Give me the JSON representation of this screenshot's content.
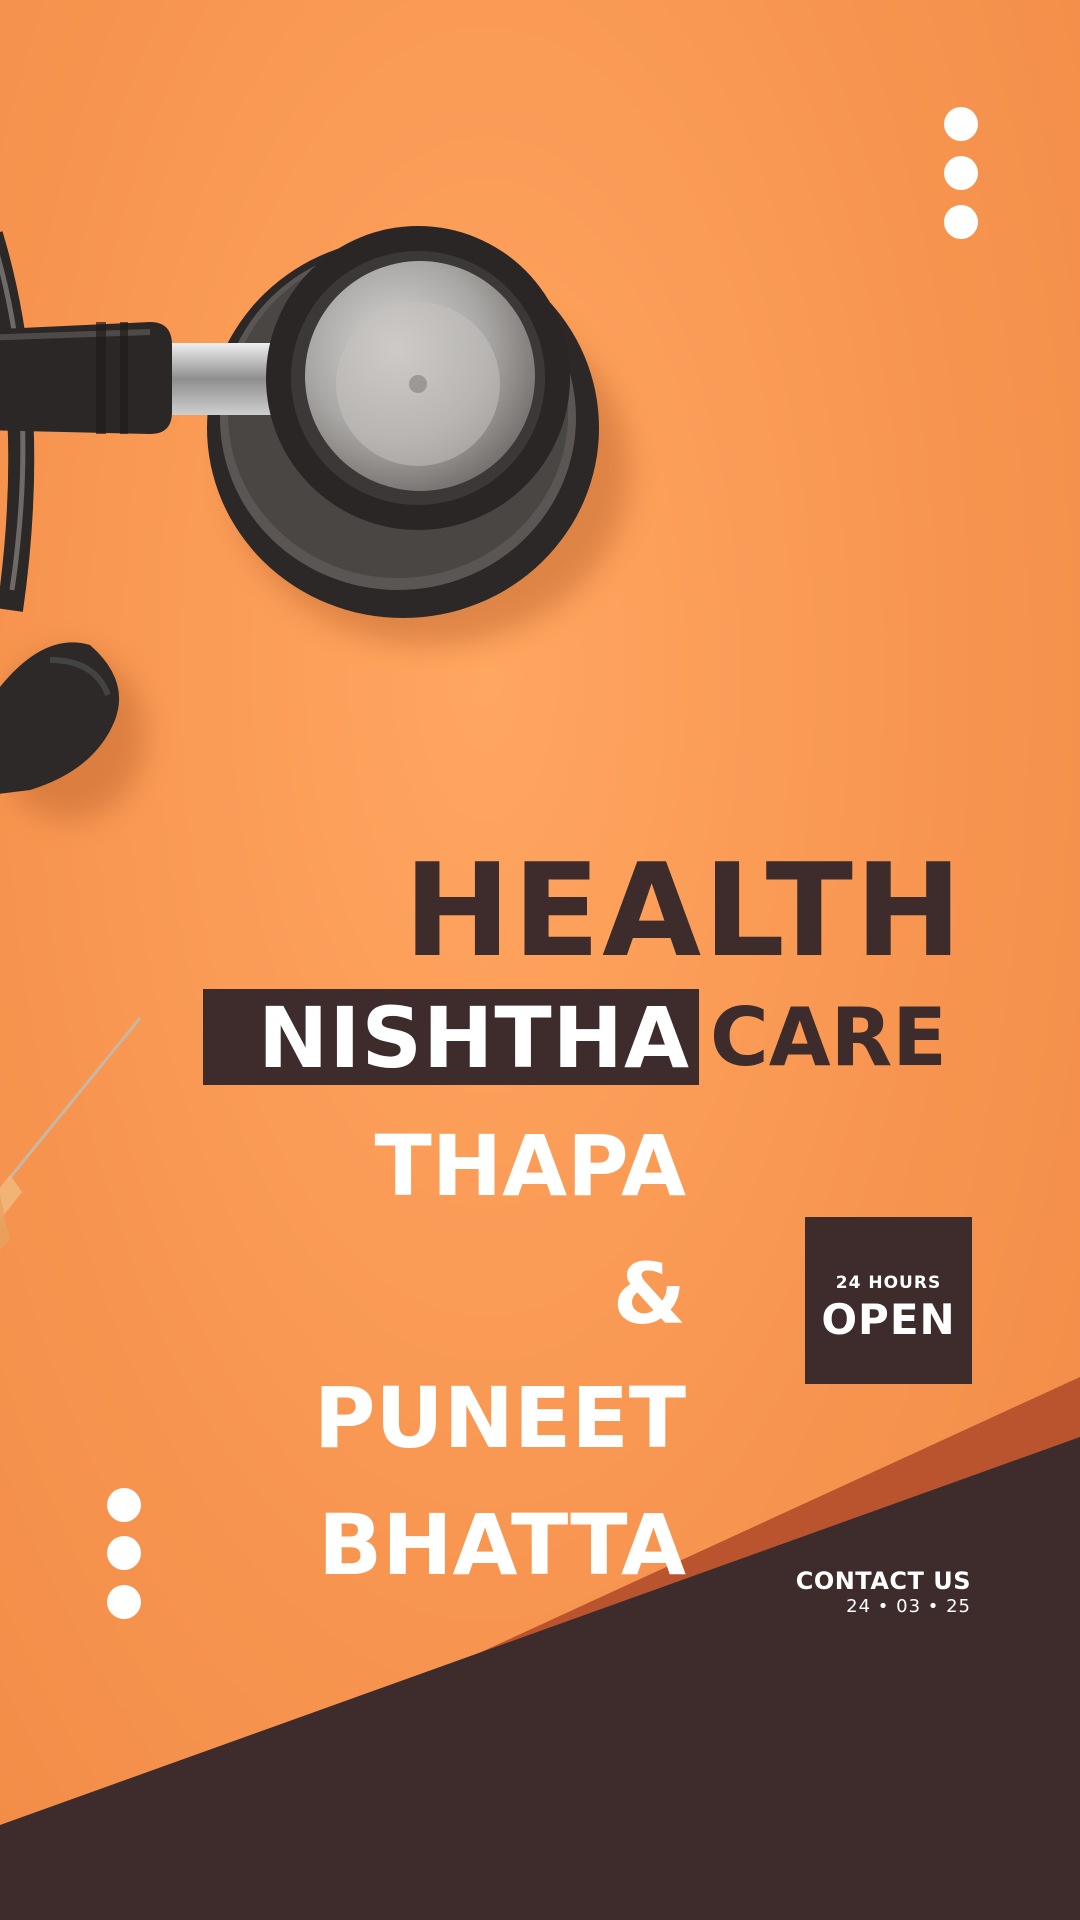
{
  "poster": {
    "title_line1": "HEALTH",
    "title_highlight": "NISHTHA",
    "title_line2": "CARE",
    "names": [
      "THAPA",
      "&",
      "PUNEET",
      "BHATTA"
    ],
    "badge": {
      "small": "24 HOURS",
      "big": "OPEN"
    },
    "contact": {
      "label": "CONTACT US",
      "date": "24 • 03 • 25"
    }
  },
  "colors": {
    "background": "#f89a52",
    "dark": "#3d2c2b",
    "accent_rust": "#b9542e",
    "text_light": "#ffffff"
  },
  "icons": [
    "stethoscope-illustration",
    "syringe-illustration",
    "vertical-dots-icon"
  ]
}
